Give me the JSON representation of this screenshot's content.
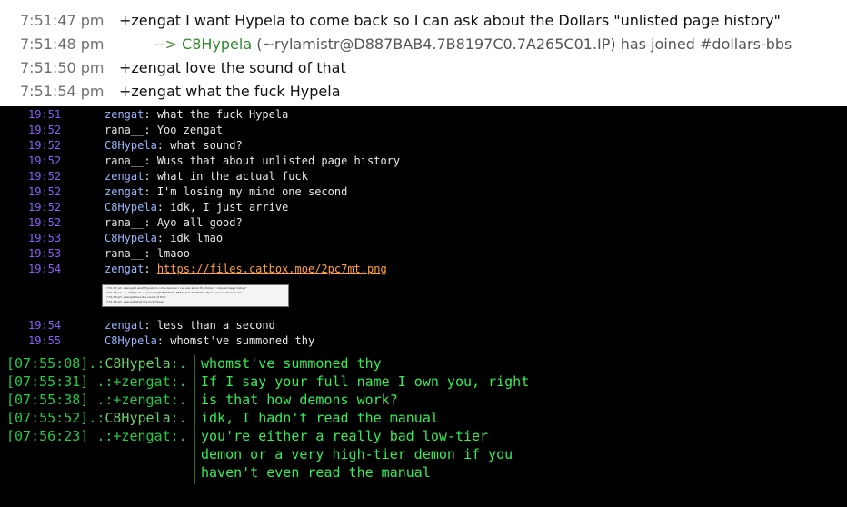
{
  "panel1": {
    "rows": [
      {
        "ts": "7:51:47 pm",
        "text": "+zengat I want Hypela to come back so I can ask about the Dollars \"unlisted page history\""
      },
      {
        "ts": "7:51:48 pm",
        "arrow": "-->",
        "nick": "C8Hypela",
        "text": "(~rylamistr@D887BAB4.7B8197C0.7A265C01.IP) has joined #dollars-bbs"
      },
      {
        "ts": "7:51:50 pm",
        "text": "+zengat love the sound of that"
      },
      {
        "ts": "7:51:54 pm",
        "text": "+zengat what the fuck Hypela"
      }
    ]
  },
  "panel2": {
    "rows": [
      {
        "ts": "19:51",
        "nick": "zengat",
        "text": "what the fuck Hypela"
      },
      {
        "ts": "19:52",
        "nick": "rana__",
        "text": "Yoo zengat"
      },
      {
        "ts": "19:52",
        "nick": "C8Hypela",
        "text": "what sound?"
      },
      {
        "ts": "19:52",
        "nick": "rana__",
        "text": "Wuss that about unlisted page history"
      },
      {
        "ts": "19:52",
        "nick": "zengat",
        "text": "what in the actual fuck"
      },
      {
        "ts": "19:52",
        "nick": "zengat",
        "text": "I'm losing my mind one second"
      },
      {
        "ts": "19:52",
        "nick": "C8Hypela",
        "text": "idk, I just arrive"
      },
      {
        "ts": "19:52",
        "nick": "rana__",
        "text": "Ayo all good?"
      },
      {
        "ts": "19:53",
        "nick": "C8Hypela",
        "text": "idk lmao"
      },
      {
        "ts": "19:53",
        "nick": "rana__",
        "text": "lmaoo"
      },
      {
        "ts": "19:54",
        "nick": "zengat",
        "link": "https://files.catbox.moe/2pc7mt.png"
      },
      {
        "ts": "19:54",
        "nick": "zengat",
        "text": "less than a second"
      },
      {
        "ts": "19:55",
        "nick": "C8Hypela",
        "text": "whomst've summoned thy"
      }
    ],
    "thumbnail_lines": [
      "7:51:47 pm   +zengat I want Hypela to come back so I can ask about the Dollars \"unlisted page history\"",
      "7:51:48 pm      --> C8Hypela (~rylamistr@D887BAB4.7B8197C0.7A265C01.IP) has joined #dollars-bbs",
      "7:51:50 pm   +zengat love the sound of that",
      "7:51:54 pm   +zengat what the fuck Hypela"
    ]
  },
  "panel3": {
    "rows": [
      {
        "prefix_a": "[07:55:08].:",
        "nick": "C8Hypela",
        "prefix_b": ":.",
        "text": "whomst've summoned thy"
      },
      {
        "prefix_a": "[07:55:31] .:",
        "nick": "+zengat",
        "prefix_b": ":.",
        "text": "If I say your full name I own you, right"
      },
      {
        "prefix_a": "[07:55:38] .:",
        "nick": "+zengat",
        "prefix_b": ":.",
        "text": "is that how demons work?"
      },
      {
        "prefix_a": "[07:55:52].:",
        "nick": "C8Hypela",
        "prefix_b": ":.",
        "text": "idk, I hadn't read the manual"
      },
      {
        "prefix_a": "[07:56:23] .:",
        "nick": "+zengat",
        "prefix_b": ":.",
        "text": "you're either a really bad low-tier"
      },
      {
        "prefix_a": "",
        "nick": "",
        "prefix_b": "",
        "text": "demon or a very high-tier demon if you"
      },
      {
        "prefix_a": "",
        "nick": "",
        "prefix_b": "",
        "text": "haven't even read the manual"
      }
    ]
  },
  "colors": {
    "panel1_bg": "#ffffff",
    "timestamp_purple": "#8b5cf6",
    "link_orange": "#ff9f43",
    "terminal_green": "#33ee55"
  }
}
